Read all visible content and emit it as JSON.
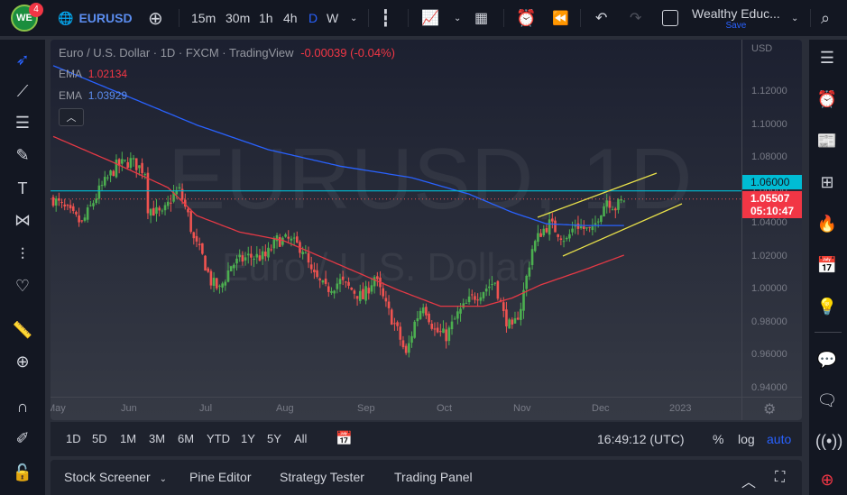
{
  "topbar": {
    "badge": "4",
    "logo": "WE",
    "symbol": "EURUSD",
    "intervals": [
      "15m",
      "30m",
      "1h",
      "4h",
      "D",
      "W"
    ],
    "active_interval": "D",
    "account": "Wealthy Educ...",
    "save": "Save"
  },
  "legend": {
    "title": "Euro / U.S. Dollar · 1D · FXCM · TradingView",
    "change": "-0.00039 (-0.04%)",
    "ema1_label": "EMA",
    "ema1_value": "1.02134",
    "ema2_label": "EMA",
    "ema2_value": "1.03929"
  },
  "watermark": {
    "symbol": "EURUSD, 1D",
    "name": "Euro / U.S. Dollar"
  },
  "price_axis": {
    "currency": "USD",
    "labels": [
      "1.12000",
      "1.10000",
      "1.08000",
      "1.06000",
      "1.04000",
      "1.02000",
      "1.00000",
      "0.98000",
      "0.96000",
      "0.94000"
    ],
    "level_label": "1.06000",
    "last_price": "1.05507",
    "countdown": "05:10:47"
  },
  "time_axis": {
    "labels": [
      "May",
      "Jun",
      "Jul",
      "Aug",
      "Sep",
      "Oct",
      "Nov",
      "Dec",
      "2023"
    ]
  },
  "range_bar": {
    "ranges": [
      "1D",
      "5D",
      "1M",
      "3M",
      "6M",
      "YTD",
      "1Y",
      "5Y",
      "All"
    ],
    "clock": "16:49:12 (UTC)",
    "pct": "%",
    "log": "log",
    "auto": "auto"
  },
  "bottom_panel": {
    "tabs": [
      "Stock Screener",
      "Pine Editor",
      "Strategy Tester",
      "Trading Panel"
    ]
  },
  "colors": {
    "up": "#26a69a",
    "up2": "#4caf50",
    "down": "#ef5350",
    "ema_red": "#e53945",
    "ema_blue": "#2962ff",
    "level": "#00bcd4",
    "channel": "#e8e04a",
    "accent": "#2962ff"
  },
  "chart_data": {
    "type": "candlestick",
    "price_anchors": [
      [
        0,
        1.055
      ],
      [
        10,
        1.04
      ],
      [
        16,
        1.06
      ],
      [
        22,
        1.075
      ],
      [
        27,
        1.078
      ],
      [
        32,
        1.072
      ],
      [
        33,
        1.05
      ],
      [
        38,
        1.045
      ],
      [
        42,
        1.058
      ],
      [
        44,
        1.06
      ],
      [
        47,
        1.045
      ],
      [
        49,
        1.03
      ],
      [
        52,
        1.02
      ],
      [
        55,
        1.005
      ],
      [
        58,
        1.0
      ],
      [
        62,
        1.015
      ],
      [
        68,
        1.02
      ],
      [
        74,
        1.02
      ],
      [
        78,
        1.03
      ],
      [
        82,
        1.03
      ],
      [
        87,
        1.025
      ],
      [
        90,
        1.01
      ],
      [
        95,
        1.0
      ],
      [
        100,
        1.005
      ],
      [
        104,
        1.0
      ],
      [
        108,
        0.995
      ],
      [
        112,
        1.008
      ],
      [
        116,
        0.99
      ],
      [
        120,
        0.975
      ],
      [
        123,
        0.96
      ],
      [
        126,
        0.98
      ],
      [
        129,
        0.992
      ],
      [
        133,
        0.975
      ],
      [
        137,
        0.972
      ],
      [
        141,
        0.985
      ],
      [
        146,
        0.995
      ],
      [
        150,
        1.0
      ],
      [
        154,
        1.005
      ],
      [
        157,
        0.985
      ],
      [
        160,
        0.975
      ],
      [
        163,
        0.99
      ],
      [
        167,
        1.025
      ],
      [
        170,
        1.035
      ],
      [
        173,
        1.04
      ],
      [
        176,
        1.035
      ],
      [
        179,
        1.03
      ],
      [
        182,
        1.04
      ],
      [
        185,
        1.037
      ],
      [
        188,
        1.035
      ],
      [
        190,
        1.045
      ],
      [
        193,
        1.055
      ],
      [
        196,
        1.05
      ],
      [
        199,
        1.055
      ]
    ],
    "ema_red": [
      [
        0,
        1.093
      ],
      [
        20,
        1.078
      ],
      [
        40,
        1.062
      ],
      [
        50,
        1.045
      ],
      [
        65,
        1.035
      ],
      [
        80,
        1.03
      ],
      [
        100,
        1.015
      ],
      [
        120,
        1.0
      ],
      [
        135,
        0.99
      ],
      [
        150,
        0.99
      ],
      [
        160,
        0.995
      ],
      [
        170,
        1.003
      ],
      [
        185,
        1.012
      ],
      [
        199,
        1.021
      ]
    ],
    "ema_blue": [
      [
        0,
        1.136
      ],
      [
        25,
        1.118
      ],
      [
        50,
        1.1
      ],
      [
        75,
        1.085
      ],
      [
        100,
        1.075
      ],
      [
        125,
        1.068
      ],
      [
        145,
        1.058
      ],
      [
        160,
        1.047
      ],
      [
        172,
        1.04
      ],
      [
        185,
        1.039
      ],
      [
        199,
        1.039
      ]
    ]
  }
}
